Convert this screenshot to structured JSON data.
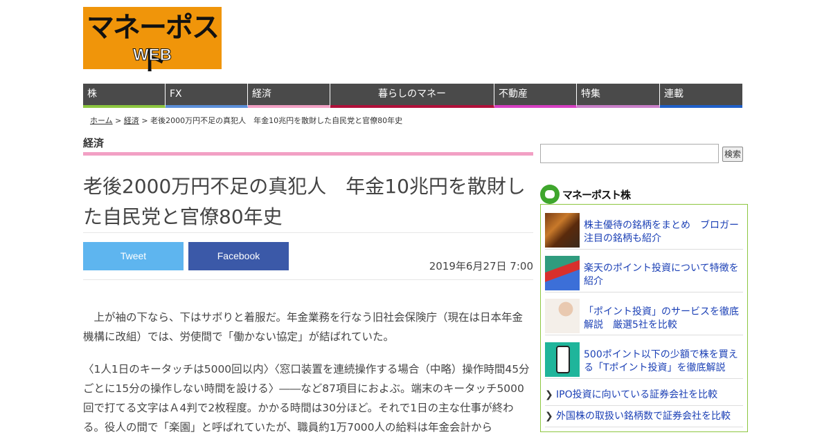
{
  "logo": {
    "line1": "マネーポスト",
    "line2": "WEB"
  },
  "nav": {
    "items": [
      {
        "label": "株",
        "color": "#8cc63f"
      },
      {
        "label": "FX",
        "color": "#5b8fd9"
      },
      {
        "label": "経済",
        "color": "#f2a0c4"
      },
      {
        "label": "暮らしのマネー",
        "color": "#b0103a"
      },
      {
        "label": "不動産",
        "color": "#d63fc3"
      },
      {
        "label": "特集",
        "color": "#c97fc9"
      },
      {
        "label": "連載",
        "color": "#1f5fc8"
      }
    ]
  },
  "breadcrumb": {
    "home": "ホーム",
    "sep": " > ",
    "category": "経済",
    "current": "老後2000万円不足の真犯人　年金10兆円を散財した自民党と官僚80年史"
  },
  "section_label": "経済",
  "headline": "老後2000万円不足の真犯人　年金10兆円を散財した自民党と官僚80年史",
  "share": {
    "tweet": "Tweet",
    "facebook": "Facebook"
  },
  "date": "2019年6月27日 7:00",
  "body": {
    "p1": "　上が袖の下なら、下はサボりと着服だ。年金業務を行なう旧社会保険庁（現在は日本年金機構に改組）では、労使間で「働かない協定」が結ばれていた。",
    "p2": "〈1人1日のキータッチは5000回以内〉〈窓口装置を連続操作する場合（中略）操作時間45分ごとに15分の操作しない時間を設ける〉――など87項目におよぶ。端末のキータッチ5000回で打てる文字はＡ4判で2枚程度。かかる時間は30分ほど。それで1日の主な仕事が終わる。役人の間で「楽園」と呼ばれていたが、職員約1万7000人の給料は年金会計から"
  },
  "sidebar": {
    "search_button": "検索",
    "brand": "マネーポスト株",
    "articles": [
      {
        "title": "株主優待の銘柄をまとめ　ブロガー注目の銘柄も紹介",
        "thumb": "food-photo"
      },
      {
        "title": "楽天のポイント投資について特徴を紹介",
        "thumb": "point-card-photo"
      },
      {
        "title": "「ポイント投資」のサービスを徹底解説　厳選5社を比較",
        "thumb": "woman-photo"
      },
      {
        "title": "500ポイント以下の少額で株を買える「Tポイント投資」を徹底解説",
        "thumb": "smartphone-photo"
      }
    ],
    "links": [
      {
        "label": "IPO投資に向いている証券会社を比較"
      },
      {
        "label": "外国株の取扱い銘柄数で証券会社を比較"
      }
    ]
  }
}
